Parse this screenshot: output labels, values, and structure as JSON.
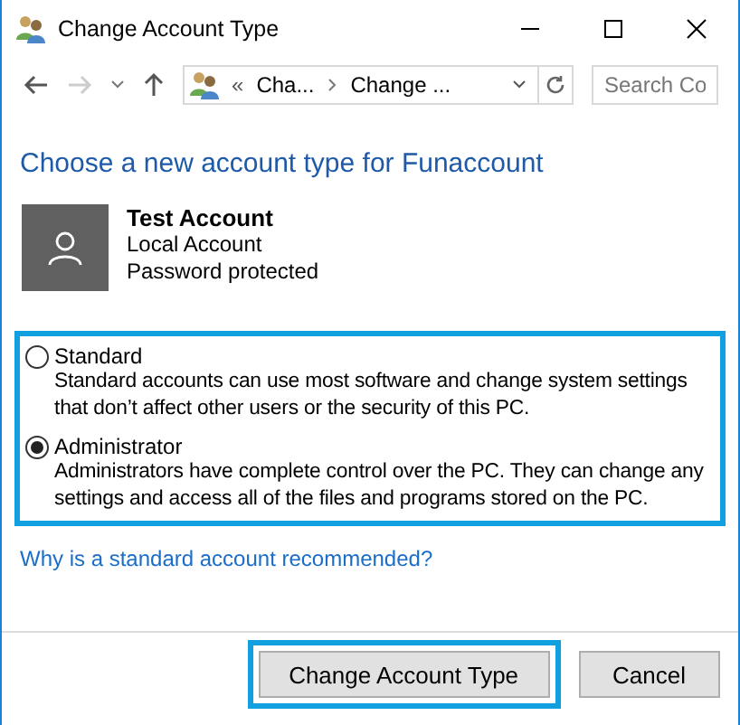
{
  "window": {
    "title": "Change Account Type"
  },
  "navigation": {
    "breadcrumb_prefix": "«",
    "breadcrumbs": [
      "Cha...",
      "Change ..."
    ],
    "search": {
      "placeholder": "Search Co"
    }
  },
  "heading": "Choose a new account type for Funaccount",
  "account": {
    "name": "Test Account",
    "lines": [
      "Local Account",
      "Password protected"
    ]
  },
  "account_types": [
    {
      "label": "Standard",
      "description": "Standard accounts can use most software and change system settings that don’t affect other users or the security of this PC.",
      "selected": false
    },
    {
      "label": "Administrator",
      "description": "Administrators have complete control over the PC. They can change any settings and access all of the files and programs stored on the PC.",
      "selected": true
    }
  ],
  "help_link": "Why is a standard account recommended?",
  "buttons": [
    {
      "label": "Change Account Type",
      "highlighted": true
    },
    {
      "label": "Cancel",
      "highlighted": false
    }
  ]
}
